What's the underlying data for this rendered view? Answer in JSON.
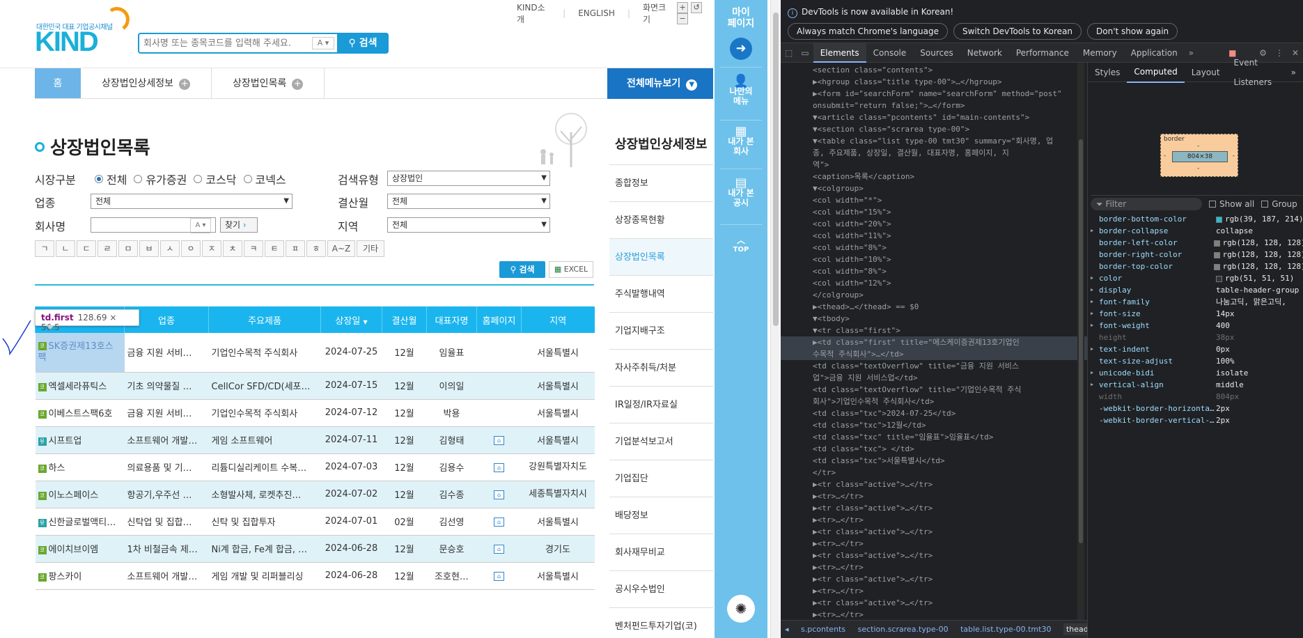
{
  "site": {
    "logo_sub": "대한민국 대표 기업공시채널",
    "logo": "KIND",
    "search_placeholder": "회사명 또는 종목코드를 입력해 주세요.",
    "search_ac": "A",
    "search_button": "검색",
    "toplinks": [
      "KIND소개",
      "ENGLISH",
      "화면크기"
    ],
    "breadcrumb": {
      "home": "홈",
      "items": [
        "상장법인상세정보",
        "상장법인목록"
      ]
    },
    "allmenu": "전체메뉴보기",
    "page_title": "상장법인목록"
  },
  "filters": {
    "market_label": "시장구분",
    "market_options": [
      "전체",
      "유가증권",
      "코스닥",
      "코넥스"
    ],
    "market_selected": "전체",
    "search_type_label": "검색유형",
    "search_type_value": "상장법인",
    "industry_label": "업종",
    "industry_value": "전체",
    "settle_label": "결산월",
    "settle_value": "전체",
    "company_label": "회사명",
    "company_ac": "A",
    "find_button": "찾기",
    "region_label": "지역",
    "region_value": "전체",
    "chars": [
      "ㄱ",
      "ㄴ",
      "ㄷ",
      "ㄹ",
      "ㅁ",
      "ㅂ",
      "ㅅ",
      "ㅇ",
      "ㅈ",
      "ㅊ",
      "ㅋ",
      "ㅌ",
      "ㅍ",
      "ㅎ",
      "A~Z",
      "기타"
    ],
    "search_button": "검색",
    "excel_button": "EXCEL"
  },
  "table": {
    "headers": [
      "회사명",
      "업종",
      "주요제품",
      "상장일",
      "결산월",
      "대표자명",
      "홈페이지",
      "지역"
    ],
    "sort_indicator": "▼",
    "rows": [
      {
        "market": "코",
        "name": "SK증권제13호스팩",
        "industry": "금융 지원 서비…",
        "product": "기업인수목적 주식회사",
        "date": "2024-07-25",
        "month": "12월",
        "ceo": "임율표",
        "home": "",
        "region": "서울특별시"
      },
      {
        "market": "코",
        "name": "엑셀세라퓨틱스",
        "industry": "기초 의약물질 …",
        "product": "CellCor SFD/CD(세포…",
        "date": "2024-07-15",
        "month": "12월",
        "ceo": "이의일",
        "home": "",
        "region": "서울특별시"
      },
      {
        "market": "코",
        "name": "이베스트스팩6호",
        "industry": "금융 지원 서비…",
        "product": "기업인수목적 주식회사",
        "date": "2024-07-12",
        "month": "12월",
        "ceo": "박용",
        "home": "",
        "region": "서울특별시"
      },
      {
        "market": "유",
        "name": "시프트업",
        "industry": "소프트웨어 개발…",
        "product": "게임 소프트웨어",
        "date": "2024-07-11",
        "month": "12월",
        "ceo": "김형태",
        "home": "⌂",
        "region": "서울특별시"
      },
      {
        "market": "코",
        "name": "하스",
        "industry": "의료용품 및 기…",
        "product": "리튬디실리케이트 수복…",
        "date": "2024-07-03",
        "month": "12월",
        "ceo": "김용수",
        "home": "⌂",
        "region": "강원특별자치도"
      },
      {
        "market": "코",
        "name": "이노스페이스",
        "industry": "항공기,우주선 …",
        "product": "소형발사체, 로켓추진…",
        "date": "2024-07-02",
        "month": "12월",
        "ceo": "김수종",
        "home": "⌂",
        "region": "세종특별자치시"
      },
      {
        "market": "유",
        "name": "신한글로벌액티브리츠",
        "industry": "신탁업 및 집합…",
        "product": "신탁 및 집합투자",
        "date": "2024-07-01",
        "month": "02월",
        "ceo": "김선영",
        "home": "⌂",
        "region": "서울특별시"
      },
      {
        "market": "코",
        "name": "에이치브이엠",
        "industry": "1차 비철금속 제…",
        "product": "Ni계 합금, Fe계 합금, …",
        "date": "2024-06-28",
        "month": "12월",
        "ceo": "문승호",
        "home": "⌂",
        "region": "경기도"
      },
      {
        "market": "코",
        "name": "팡스카이",
        "industry": "소프트웨어 개발…",
        "product": "게임 개발 및 리퍼블리싱",
        "date": "2024-06-28",
        "month": "12월",
        "ceo": "조호현…",
        "home": "⌂",
        "region": "서울특별시"
      }
    ]
  },
  "tooltip": {
    "tag": "td.first",
    "size": "128.69 × 56.5"
  },
  "sidebar": {
    "title": "상장법인상세정보",
    "items": [
      "종합정보",
      "상장종목현황",
      "상장법인목록",
      "주식발행내역",
      "기업지배구조",
      "자사주취득/처분",
      "IR일정/IR자료실",
      "기업분석보고서",
      "기업집단",
      "배당정보",
      "회사재무비교",
      "공시우수법인",
      "벤처펀드투자기업(코)"
    ],
    "active": "상장법인목록"
  },
  "bluebar": {
    "mypage": "마이\n페이지",
    "my_company": "나만의\n메뉴",
    "viewed_company": "내가 본\n회사",
    "viewed_disclosure": "내가 본\n공시",
    "top": "TOP"
  },
  "devtools": {
    "notice": "DevTools is now available in Korean!",
    "notice_buttons": [
      "Always match Chrome's language",
      "Switch DevTools to Korean",
      "Don't show again"
    ],
    "tabs": [
      "Elements",
      "Console",
      "Sources",
      "Network",
      "Performance",
      "Memory",
      "Application"
    ],
    "active_tab": "Elements",
    "error_count": "4",
    "side_tabs": [
      "Styles",
      "Computed",
      "Layout",
      "Event Listeners"
    ],
    "active_side_tab": "Computed",
    "box_label": "border",
    "box_inner": "804×38",
    "box_dash": "-",
    "filter_placeholder": "Filter",
    "show_all": "Show all",
    "group": "Group",
    "crumbs": [
      "s.pcontents",
      "section.scrarea.type-00",
      "table.list.type-00.tmt30",
      "thead"
    ],
    "computed": [
      {
        "name": "border-bottom-color",
        "value": "rgb(39, 187, 214)",
        "swatch": "#27bbd6",
        "ex": false,
        "dim": false
      },
      {
        "name": "border-collapse",
        "value": "collapse",
        "ex": true,
        "dim": false
      },
      {
        "name": "border-left-color",
        "value": "rgb(128, 128, 128)",
        "swatch": "#808080",
        "ex": false,
        "dim": false
      },
      {
        "name": "border-right-color",
        "value": "rgb(128, 128, 128)",
        "swatch": "#808080",
        "ex": false,
        "dim": false
      },
      {
        "name": "border-top-color",
        "value": "rgb(128, 128, 128)",
        "swatch": "#808080",
        "ex": false,
        "dim": false
      },
      {
        "name": "color",
        "value": "rgb(51, 51, 51)",
        "swatch": "#333333",
        "ex": true,
        "dim": false
      },
      {
        "name": "display",
        "value": "table-header-group",
        "ex": true,
        "dim": false
      },
      {
        "name": "font-family",
        "value": "나눔고딕, 맑은고딕,",
        "ex": true,
        "dim": false
      },
      {
        "name": "font-size",
        "value": "14px",
        "ex": true,
        "dim": false
      },
      {
        "name": "font-weight",
        "value": "400",
        "ex": true,
        "dim": false
      },
      {
        "name": "height",
        "value": "38px",
        "ex": false,
        "dim": true
      },
      {
        "name": "text-indent",
        "value": "0px",
        "ex": true,
        "dim": false
      },
      {
        "name": "text-size-adjust",
        "value": "100%",
        "ex": false,
        "dim": false
      },
      {
        "name": "unicode-bidi",
        "value": "isolate",
        "ex": true,
        "dim": false
      },
      {
        "name": "vertical-align",
        "value": "middle",
        "ex": true,
        "dim": false
      },
      {
        "name": "width",
        "value": "804px",
        "ex": false,
        "dim": true
      },
      {
        "name": "-webkit-border-horizonta…",
        "value": "2px",
        "ex": false,
        "dim": false
      },
      {
        "name": "-webkit-border-vertical-…",
        "value": "2px",
        "ex": false,
        "dim": false
      }
    ]
  },
  "dom_lines": [
    "<section class=\"contents\">",
    "▶<hgroup class=\"title type-00\">…</hgroup>",
    "▶<form id=\"searchForm\" name=\"searchForm\" method=\"post\"",
    "  onsubmit=\"return false;\">…</form>",
    "▼<article class=\"pcontents\" id=\"main-contents\">",
    "  ▼<section class=\"scrarea type-00\">",
    "    ▼<table class=\"list type-00 tmt30\" summary=\"회사명, 업",
    "      종, 주요제품, 상장일, 결산월, 대표자명, 홈페이지, 지",
    "      역\">",
    "        <caption>목록</caption>",
    "      ▼<colgroup>",
    "          <col width=\"*\">",
    "          <col width=\"15%\">",
    "          <col width=\"20%\">",
    "          <col width=\"11%\">",
    "          <col width=\"8%\">",
    "          <col width=\"10%\">",
    "          <col width=\"8%\">",
    "          <col width=\"12%\">",
    "        </colgroup>",
    "      ▶<thead>…</thead> == $0",
    "      ▼<tbody>",
    "        ▼<tr class=\"first\">",
    "          ▶<td class=\"first\" title=\"에스케이증권제13호기업인",
    "            수목적 주식회사\">…</td>",
    "            <td class=\"textOverflow\" title=\"금융 지원 서비스",
    "            업\">금융 지원 서비스업</td>",
    "            <td class=\"textOverflow\" title=\"기업인수목적 주식",
    "            회사\">기업인수목적 주식회사</td>",
    "            <td class=\"txc\">2024-07-25</td>",
    "            <td class=\"txc\">12월</td>",
    "            <td class=\"txc\" title=\"임율표\">임율표</td>",
    "            <td class=\"txc\"> </td>",
    "            <td class=\"txc\">서울특별시</td>",
    "          </tr>",
    "        ▶<tr class=\"active\">…</tr>",
    "        ▶<tr>…</tr>",
    "        ▶<tr class=\"active\">…</tr>",
    "        ▶<tr>…</tr>",
    "        ▶<tr class=\"active\">…</tr>",
    "        ▶<tr>…</tr>",
    "        ▶<tr class=\"active\">…</tr>",
    "        ▶<tr>…</tr>",
    "        ▶<tr class=\"active\">…</tr>",
    "        ▶<tr>…</tr>",
    "        ▶<tr class=\"active\">…</tr>",
    "        ▶<tr>…</tr>"
  ]
}
